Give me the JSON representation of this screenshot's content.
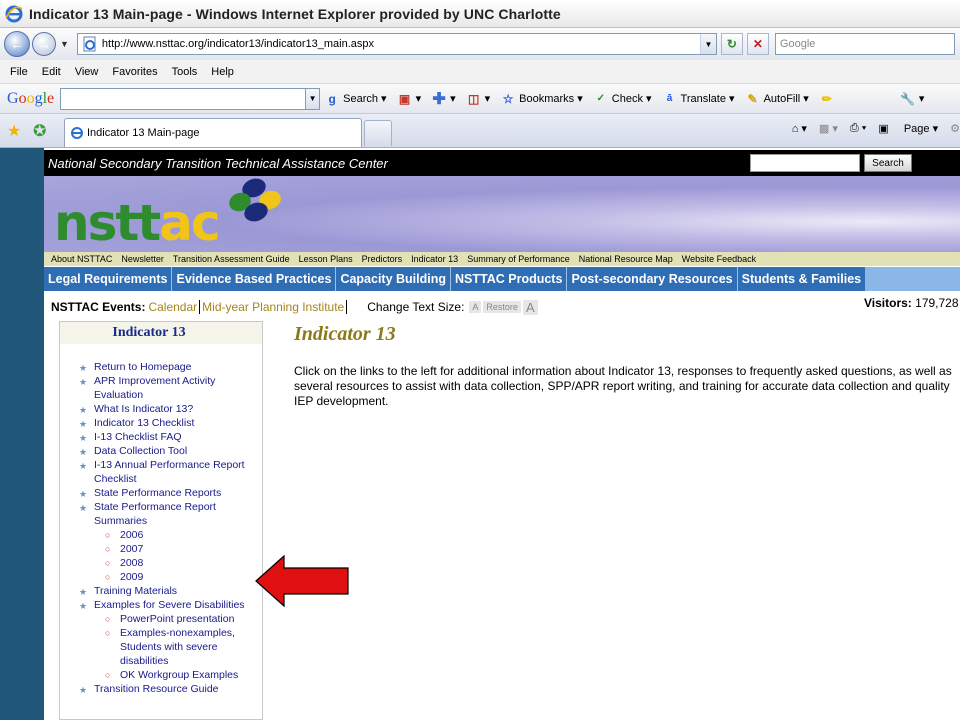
{
  "window": {
    "title": "Indicator 13 Main-page - Windows Internet Explorer provided by UNC Charlotte"
  },
  "address_bar": {
    "url": "http://www.nsttac.org/indicator13/indicator13_main.aspx",
    "search_placeholder": "Google"
  },
  "menu": [
    "File",
    "Edit",
    "View",
    "Favorites",
    "Tools",
    "Help"
  ],
  "google_toolbar": {
    "logo": "Google",
    "search_label": "Search",
    "bookmarks_label": "Bookmarks",
    "check_label": "Check",
    "translate_label": "Translate",
    "autofill_label": "AutoFill"
  },
  "tab": {
    "title": "Indicator 13 Main-page"
  },
  "command_bar": {
    "page_label": "Page"
  },
  "site": {
    "org_name": "National Secondary Transition Technical Assistance Center",
    "search_button": "Search",
    "logo_part1": "nstt",
    "logo_part2": "ac",
    "top_links": [
      "About NSTTAC",
      "Newsletter",
      "Transition Assessment Guide",
      "Lesson Plans",
      "Predictors",
      "Indicator 13",
      "Summary of Performance",
      "National Resource Map",
      "Website Feedback"
    ],
    "main_nav": [
      "Legal Requirements",
      "Evidence Based Practices",
      "Capacity Building",
      "NSTTAC Products",
      "Post-secondary Resources",
      "Students & Families"
    ],
    "events_label": "NSTTAC Events:",
    "events_links": [
      "Calendar",
      "Mid-year Planning Institute"
    ],
    "text_size_label": "Change Text Size:",
    "text_size_small": "A",
    "text_size_restore": "Restore",
    "text_size_large": "A",
    "visitors_label": "Visitors:",
    "visitors_count": "179,728"
  },
  "sidebar": {
    "header": "Indicator 13",
    "items": [
      {
        "label": "Return to Homepage"
      },
      {
        "label": "APR Improvement Activity Evaluation"
      },
      {
        "label": "What Is Indicator 13?"
      },
      {
        "label": "Indicator 13 Checklist"
      },
      {
        "label": "I-13 Checklist FAQ"
      },
      {
        "label": "Data Collection Tool"
      },
      {
        "label": "I-13 Annual Performance Report Checklist"
      },
      {
        "label": "State Performance Reports"
      },
      {
        "label": "State Performance Report Summaries"
      },
      {
        "label": "Training Materials"
      },
      {
        "label": "Examples for Severe Disabilities"
      },
      {
        "label": "Transition Resource Guide"
      }
    ],
    "summary_years": [
      "2006",
      "2007",
      "2008",
      "2009"
    ],
    "severe_sub": [
      "PowerPoint presentation",
      "Examples-nonexamples, Students with severe disabilities",
      "OK Workgroup Examples"
    ]
  },
  "main": {
    "title": "Indicator 13",
    "body": "Click on the links to the left for additional information about Indicator 13, responses to frequently asked questions, as well as several resources to assist with data collection, SPP/APR report writing, and training for accurate data collection and quality IEP development."
  },
  "colors": {
    "nav_blue": "#2f6db4",
    "left_strip": "#21577a",
    "arrow_red": "#e01010",
    "title_gold": "#8a7a1a"
  }
}
